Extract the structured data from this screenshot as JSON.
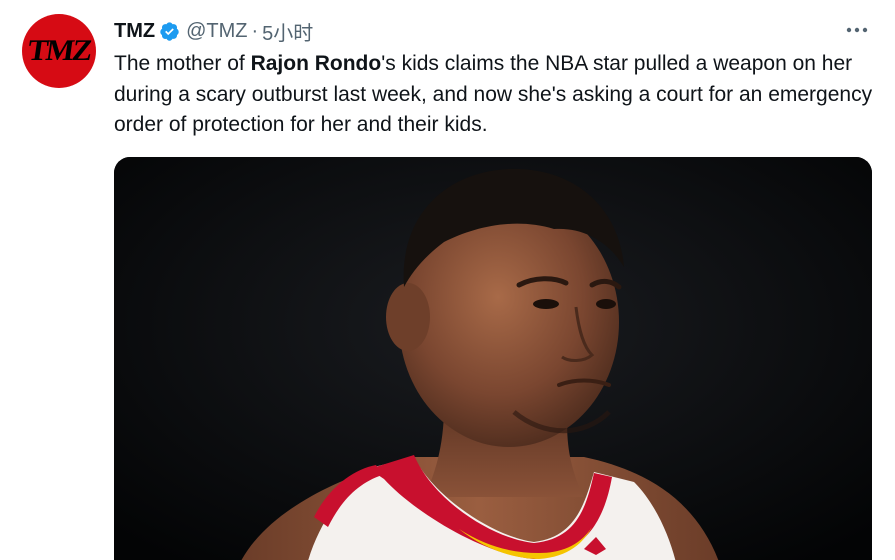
{
  "author": {
    "avatar_text": "TMZ",
    "name": "TMZ",
    "handle": "@TMZ",
    "separator": "·",
    "time": "5小时",
    "verified": true,
    "verified_icon": "verified-badge-icon",
    "avatar_color": "#d60b14"
  },
  "tweet": {
    "text_before": "The mother of ",
    "mention": "Rajon Rondo",
    "text_after": "'s kids claims the NBA star pulled a weapon on her during a scary outburst last week, and now she's asking a court for an emergency order of protection for her and their kids."
  },
  "menu": {
    "icon": "more-options-icon"
  },
  "colors": {
    "text": "#0f1419",
    "secondary": "#536471",
    "verified": "#1d9bf0",
    "jersey_red": "#c8102e",
    "jersey_white": "#f4f1ee",
    "jersey_yellow": "#f5c400"
  },
  "media": {
    "icon": "photo-basketball-player"
  }
}
